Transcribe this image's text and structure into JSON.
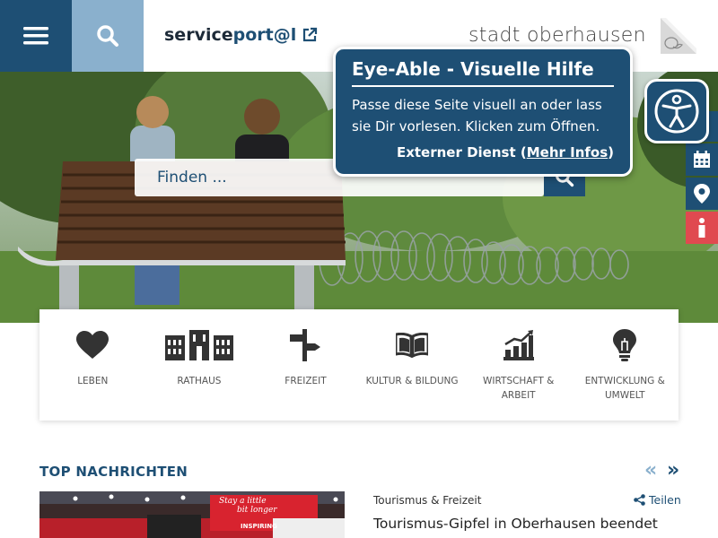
{
  "header": {
    "menu_icon": "hamburger-menu-icon",
    "search_icon": "search-icon",
    "serviceportal_prefix": "service",
    "serviceportal_suffix": "port@l",
    "external_icon": "external-link-icon",
    "logo_text": "stadt oberhausen"
  },
  "hero": {
    "search_placeholder": "Finden ..."
  },
  "eye_able": {
    "title": "Eye-Able - Visuelle Hilfe",
    "text": "Passe diese Seite visuell an oder lass sie Dir vorlesen. Klicken zum Öffnen.",
    "external_prefix": "Externer Dienst (",
    "more_link": "Mehr Infos",
    "external_suffix": ")"
  },
  "side_tools": [
    "calendar-icon",
    "map-pin-icon",
    "info-icon"
  ],
  "categories": [
    {
      "icon": "heart-icon",
      "label": "Leben"
    },
    {
      "icon": "town-hall-icon",
      "label": "Rathaus"
    },
    {
      "icon": "signpost-icon",
      "label": "Freizeit"
    },
    {
      "icon": "book-icon",
      "label": "Kultur & Bildung"
    },
    {
      "icon": "chart-icon",
      "label": "Wirtschaft & Arbeit"
    },
    {
      "icon": "lightbulb-icon",
      "label": "Entwicklung & Umwelt"
    }
  ],
  "news": {
    "heading": "TOP NACHRICHTEN",
    "prev": "«",
    "next": "»",
    "category": "Tourismus & Freizeit",
    "share": "Teilen",
    "title": "Tourismus-Gipfel in Oberhausen beendet",
    "banner_text_1": "Stay a little",
    "banner_text_2": "bit longer",
    "banner_text_3": "INSPIRING"
  },
  "colors": {
    "brand_blue": "#1e4f74",
    "light_blue": "#8ab0cd",
    "info_red": "#e04a50"
  }
}
